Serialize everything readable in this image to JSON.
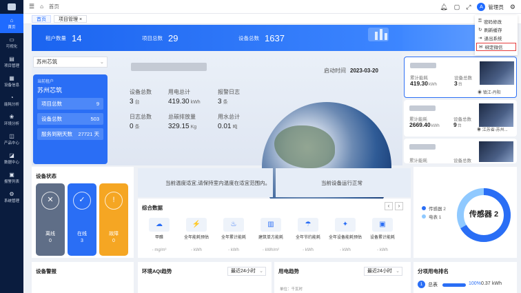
{
  "sidebar": {
    "items": [
      {
        "label": "首页",
        "icon": "home-icon",
        "glyph": "⌂"
      },
      {
        "label": "可视化",
        "icon": "monitor-icon",
        "glyph": "▭"
      },
      {
        "label": "项目管理",
        "icon": "folder-icon",
        "glyph": "▤"
      },
      {
        "label": "设备信息",
        "icon": "device-icon",
        "glyph": "▦"
      },
      {
        "label": "能耗分析",
        "icon": "energy-icon",
        "glyph": "◔"
      },
      {
        "label": "环境分析",
        "icon": "environment-icon",
        "glyph": "❀"
      },
      {
        "label": "产品中心",
        "icon": "product-icon",
        "glyph": "◫"
      },
      {
        "label": "数据中心",
        "icon": "data-icon",
        "glyph": "◪"
      },
      {
        "label": "报警列表",
        "icon": "alarm-icon",
        "glyph": "▣"
      },
      {
        "label": "系统管理",
        "icon": "settings-icon",
        "glyph": "⚙"
      }
    ]
  },
  "topbar": {
    "breadcrumb": "首页",
    "username": "管理员",
    "avatar_letter": "A"
  },
  "tabs": [
    {
      "label": "首页"
    },
    {
      "label": "项目管理",
      "close": "×"
    }
  ],
  "user_menu": {
    "items": [
      "密码修改",
      "刷新缓存",
      "退出系统",
      "绑定微信"
    ]
  },
  "banner": {
    "stats": [
      {
        "label": "租户数量",
        "value": "14"
      },
      {
        "label": "项目总数",
        "value": "29"
      },
      {
        "label": "设备总数",
        "value": "1637"
      }
    ]
  },
  "tenant": {
    "selected": "苏州芯筑",
    "caption": "当前租户",
    "name": "苏州芯筑",
    "rows": [
      {
        "label": "项目总数",
        "value": "9"
      },
      {
        "label": "设备总数",
        "value": "503"
      },
      {
        "label": "服务到期天数",
        "value": "27721 天"
      }
    ]
  },
  "project": {
    "start_label": "启动时间",
    "start_date": "2023-03-20",
    "stats": [
      {
        "label": "设备总数",
        "value": "3",
        "unit": "台"
      },
      {
        "label": "用电总计",
        "value": "419.30",
        "unit": "kWh"
      },
      {
        "label": "报警日志",
        "value": "3",
        "unit": "条"
      },
      {
        "label": "日志总数",
        "value": "0",
        "unit": "条"
      },
      {
        "label": "总碳排放量",
        "value": "329.15",
        "unit": "Kg"
      },
      {
        "label": "用水总计",
        "value": "0.01",
        "unit": "吨"
      }
    ]
  },
  "project_cards": [
    {
      "energy_label": "累计能耗",
      "energy_value": "419.30",
      "energy_unit": "kWh",
      "device_label": "设备总数",
      "device_value": "3",
      "device_unit": "台",
      "location": "镇江-丹阳"
    },
    {
      "energy_label": "累计能耗",
      "energy_value": "2669.40",
      "energy_unit": "kWh",
      "device_label": "设备总数",
      "device_value": "9",
      "device_unit": "台",
      "location": "江苏省-苏州..."
    },
    {
      "energy_label": "累计能耗",
      "energy_label2": "设备总数"
    }
  ],
  "device_status": {
    "title": "设备状态",
    "items": [
      {
        "label": "离线",
        "count": "0",
        "color": "#5f6e87",
        "icon": "offline-icon",
        "glyph": "✕"
      },
      {
        "label": "在线",
        "count": "3",
        "color": "#2a6ef5",
        "icon": "online-icon",
        "glyph": "✓"
      },
      {
        "label": "故障",
        "count": "0",
        "color": "#f5a623",
        "icon": "fault-icon",
        "glyph": "!"
      }
    ]
  },
  "notices": [
    "当前温度适宜,请保持室内温度在适宜范围内。",
    "当前设备运行正常"
  ],
  "combined": {
    "title": "综合数据",
    "prev": "‹",
    "next": "›",
    "items": [
      {
        "label": "甲醛",
        "unit": "- mg/m³",
        "glyph": "☁"
      },
      {
        "label": "全年能耗预估",
        "unit": "- kWh",
        "glyph": "⚡"
      },
      {
        "label": "全年累计能耗",
        "unit": "- kWh",
        "glyph": "♨"
      },
      {
        "label": "建筑单方能耗",
        "unit": "- kWh/m²",
        "glyph": "▥"
      },
      {
        "label": "全年节约能耗",
        "unit": "- kWh",
        "glyph": "☂"
      },
      {
        "label": "全年设备能耗预估",
        "unit": "- kWh",
        "glyph": "✦"
      },
      {
        "label": "设备累计能耗",
        "unit": "- kWh",
        "glyph": "▣"
      }
    ]
  },
  "donut": {
    "center": "传感器 2",
    "legend": [
      {
        "label": "传感器 2",
        "color": "#2a6ef5"
      },
      {
        "label": "电表 1",
        "color": "#8fc9ff"
      }
    ]
  },
  "bottom": {
    "alarm": {
      "title": "设备警报"
    },
    "aqi": {
      "title": "环境AQI趋势",
      "range": "最近24小时"
    },
    "power": {
      "title": "用电趋势",
      "range": "最近24小时",
      "ylabel": "单位：千瓦时"
    },
    "ranking": {
      "title": "分项用电排名",
      "rank": "1",
      "name": "总表",
      "percent": "100%",
      "value": "0.37",
      "unit": "kWh",
      "fill": 1.0
    }
  }
}
